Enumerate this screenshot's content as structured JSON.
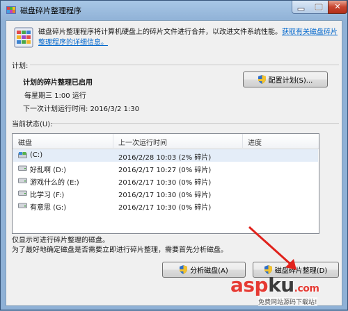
{
  "window": {
    "title": "磁盘碎片整理程序",
    "close_glyph": "✕"
  },
  "header": {
    "description": "磁盘碎片整理程序将计算机硬盘上的碎片文件进行合并，以改进文件系统性能。",
    "link_text": "获取有关磁盘碎片整理程序的详细信息。"
  },
  "schedule": {
    "section_label": "计划:",
    "status": "计划的碎片整理已启用",
    "frequency": "每星期三 1:00 运行",
    "next_run": "下一次计划运行时间: 2016/3/2 1:30",
    "configure_button": "配置计划(S)..."
  },
  "current_status": {
    "section_label": "当前状态(U):",
    "columns": [
      "磁盘",
      "上一次运行时间",
      "进度"
    ],
    "rows": [
      {
        "disk": "(C:)",
        "last_run": "2016/2/28 10:03 (2% 碎片)",
        "progress": ""
      },
      {
        "disk": "好乱啊 (D:)",
        "last_run": "2016/2/17 10:27 (0% 碎片)",
        "progress": ""
      },
      {
        "disk": "游戏什么的 (E:)",
        "last_run": "2016/2/17 10:30 (0% 碎片)",
        "progress": ""
      },
      {
        "disk": "比学习 (F:)",
        "last_run": "2016/2/17 10:30 (0% 碎片)",
        "progress": ""
      },
      {
        "disk": "有意思 (G:)",
        "last_run": "2016/2/17 10:30 (0% 碎片)",
        "progress": ""
      }
    ]
  },
  "footer": {
    "note1": "仅显示可进行碎片整理的磁盘。",
    "note2": "为了最好地确定磁盘是否需要立即进行碎片整理，需要首先分析磁盘。",
    "analyze_button": "分析磁盘(A)",
    "defrag_button": "磁盘碎片整理(D)"
  },
  "watermark": {
    "brand_a": "asp",
    "brand_b": "ku",
    "brand_c": ".com",
    "sub": "免费网站源码下载站!"
  },
  "colors": {
    "arrow": "#e0221c",
    "link": "#0066cc",
    "selected_row": "#e4edf8"
  }
}
